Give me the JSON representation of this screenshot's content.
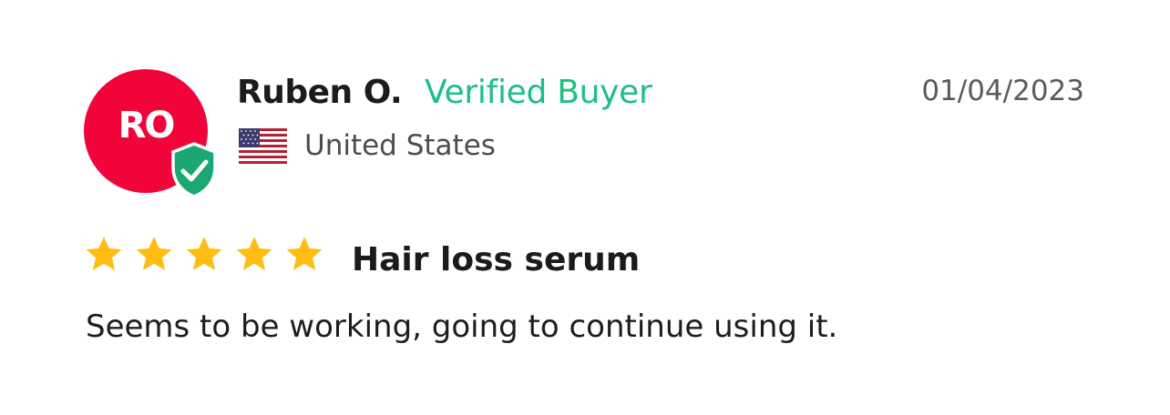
{
  "review": {
    "author": {
      "initials": "RO",
      "name": "Ruben O.",
      "avatar_color": "#f0043a",
      "verified_label": "Verified Buyer",
      "verified_color": "#1dbf84",
      "badge_color": "#1aa774",
      "country": "United States",
      "flag_icon": "us-flag-icon"
    },
    "date": "01/04/2023",
    "rating": 5,
    "rating_max": 5,
    "star_color": "#ffbd13",
    "title": "Hair loss serum",
    "body": "Seems to be working, going to continue using it."
  }
}
